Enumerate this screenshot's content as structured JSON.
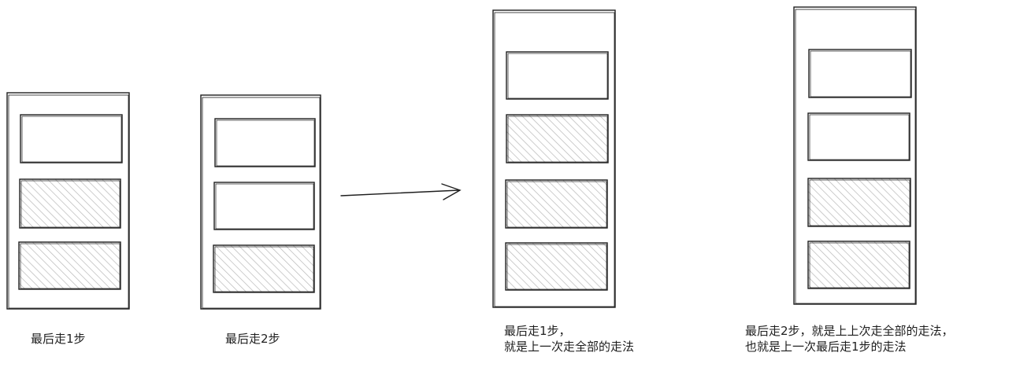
{
  "captions": {
    "step1": [
      "最后走1步"
    ],
    "step2": [
      "最后走2步"
    ],
    "result1": [
      "最后走1步，",
      "就是上一次走全部的走法"
    ],
    "result2": [
      "最后走2步，就是上上次走全部的走法，",
      "也就是上一次最后走1步的走法"
    ]
  },
  "colors": {
    "stroke": "#1e1e1e",
    "hatch": "#b8b8b8",
    "background": "#ffffff"
  },
  "figures": [
    {
      "name": "figure-step1",
      "cells": [
        "empty",
        "filled",
        "filled"
      ]
    },
    {
      "name": "figure-step2",
      "cells": [
        "empty",
        "empty",
        "filled"
      ]
    },
    {
      "name": "figure-result1",
      "cells": [
        "empty",
        "filled",
        "filled",
        "filled"
      ]
    },
    {
      "name": "figure-result2",
      "cells": [
        "empty",
        "empty",
        "filled",
        "filled"
      ]
    }
  ]
}
